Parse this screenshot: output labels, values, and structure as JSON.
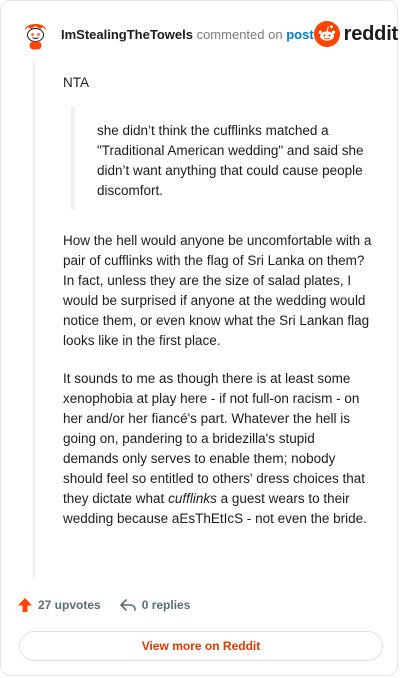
{
  "header": {
    "username": "ImStealingTheTowels",
    "action_text": "commented on",
    "post_link": "post",
    "brand": "reddit"
  },
  "comment": {
    "intro": "NTA",
    "quote": "she didn’t think the cufflinks matched a \"Traditional American wedding\" and said she didn’t want anything that could cause people discomfort.",
    "paragraph_1": "How the hell would anyone be uncomfortable with a pair of cufflinks with the flag of Sri Lanka on them? In fact, unless they are the size of salad plates, I would be surprised if anyone at the wedding would notice them, or even know what the Sri Lankan flag looks like in the first place.",
    "paragraph_2_part_1": "It sounds to me as though there is at least some xenophobia at play here - if not full-on racism - on her and/or her fiancé's part. Whatever the hell is going on, pandering to a bridezilla's stupid demands only serves to enable them; nobody should feel so entitled to others' dress choices that they dictate what ",
    "paragraph_2_italic": "cufflinks",
    "paragraph_2_part_2": " a guest wears to their wedding because aEsThEtIcS - not even the bride."
  },
  "footer": {
    "upvotes": "27 upvotes",
    "replies": "0 replies",
    "view_more": "View more on Reddit"
  },
  "colors": {
    "brand_orange": "#ff4500",
    "link_blue": "#0079d3",
    "view_more_text": "#d93a00"
  },
  "icons": {
    "avatar": "snoo-avatar",
    "brand": "reddit-logo-icon",
    "upvote": "upvote-arrow-icon",
    "reply": "reply-icon"
  }
}
